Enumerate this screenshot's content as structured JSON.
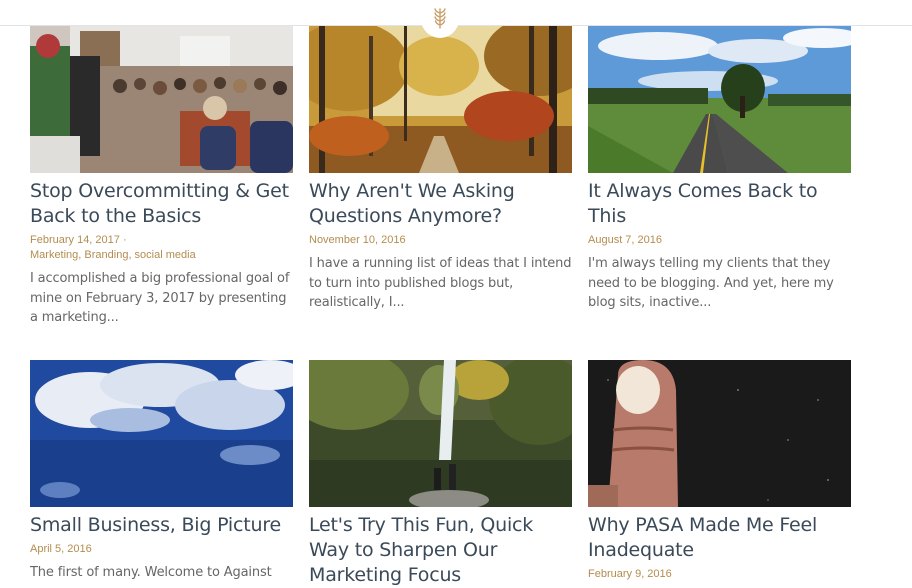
{
  "header": {
    "logo_icon": "wheat-logo-icon"
  },
  "posts": [
    {
      "title": "Stop Overcommitting & Get Back to the Basics",
      "date": "February 14, 2017",
      "date_suffix": " ·",
      "categories": "Marketing, Branding, social media",
      "excerpt": "I accomplished a big professional goal of mine on February 3, 2017 by presenting a marketing..."
    },
    {
      "title": "Why Aren't We Asking Questions Anymore?",
      "date": "November 10, 2016",
      "excerpt": "I have a running list of ideas that I intend to turn into published blogs but, realistically, I..."
    },
    {
      "title": "It Always Comes Back to This",
      "date": "August 7, 2016",
      "excerpt": "I'm always telling my clients that they need to be blogging. And yet, here my blog sits, inactive..."
    },
    {
      "title": "Small Business, Big Picture",
      "date": "April 5, 2016",
      "excerpt": "The first of many. Welcome to Against"
    },
    {
      "title": "Let's Try This Fun, Quick Way to Sharpen Our Marketing Focus",
      "date": ""
    },
    {
      "title": "Why PASA Made Me Feel Inadequate",
      "date": "February 9, 2016"
    }
  ],
  "colors": {
    "accent": "#b38d4e",
    "title": "#3b4a59",
    "text": "#666666"
  }
}
